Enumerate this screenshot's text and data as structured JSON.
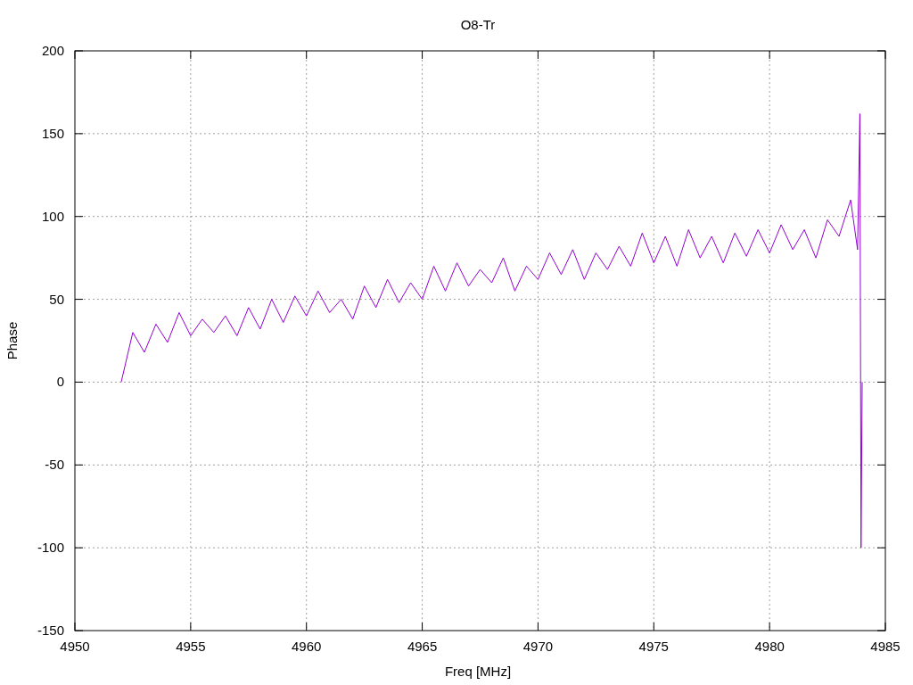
{
  "chart_data": {
    "type": "line",
    "grid": true,
    "title": "O8-Tr",
    "xlabel": "Freq [MHz]",
    "ylabel": "Phase",
    "xlim": [
      4950,
      4985
    ],
    "ylim": [
      -150,
      200
    ],
    "xticks": [
      4950,
      4955,
      4960,
      4965,
      4970,
      4975,
      4980,
      4985
    ],
    "yticks": [
      -150,
      -100,
      -50,
      0,
      50,
      100,
      150,
      200
    ],
    "x": [
      4952,
      4952.5,
      4953,
      4953.5,
      4954,
      4954.5,
      4955,
      4955.5,
      4956,
      4956.5,
      4957,
      4957.5,
      4958,
      4958.5,
      4959,
      4959.5,
      4960,
      4960.5,
      4961,
      4961.5,
      4962,
      4962.5,
      4963,
      4963.5,
      4964,
      4964.5,
      4965,
      4965.5,
      4966,
      4966.5,
      4967,
      4967.5,
      4968,
      4968.5,
      4969,
      4969.5,
      4970,
      4970.5,
      4971,
      4971.5,
      4972,
      4972.5,
      4973,
      4973.5,
      4974,
      4974.5,
      4975,
      4975.5,
      4976,
      4976.5,
      4977,
      4977.5,
      4978,
      4978.5,
      4979,
      4979.5,
      4980,
      4980.5,
      4981,
      4981.5,
      4982,
      4982.5,
      4983,
      4983.5,
      4983.8,
      4983.9,
      4983.95,
      4984
    ],
    "series": [
      {
        "color": "#9400d3",
        "values": [
          0,
          30,
          18,
          35,
          24,
          42,
          28,
          38,
          30,
          40,
          28,
          45,
          32,
          50,
          36,
          52,
          40,
          55,
          42,
          50,
          38,
          58,
          45,
          62,
          48,
          60,
          50,
          70,
          55,
          72,
          58,
          68,
          60,
          75,
          55,
          70,
          62,
          78,
          65,
          80,
          62,
          78,
          68,
          82,
          70,
          90,
          72,
          88,
          70,
          92,
          75,
          88,
          72,
          90,
          76,
          92,
          78,
          95,
          80,
          92,
          75,
          98,
          88,
          110,
          80,
          162,
          -100,
          0
        ]
      }
    ]
  }
}
